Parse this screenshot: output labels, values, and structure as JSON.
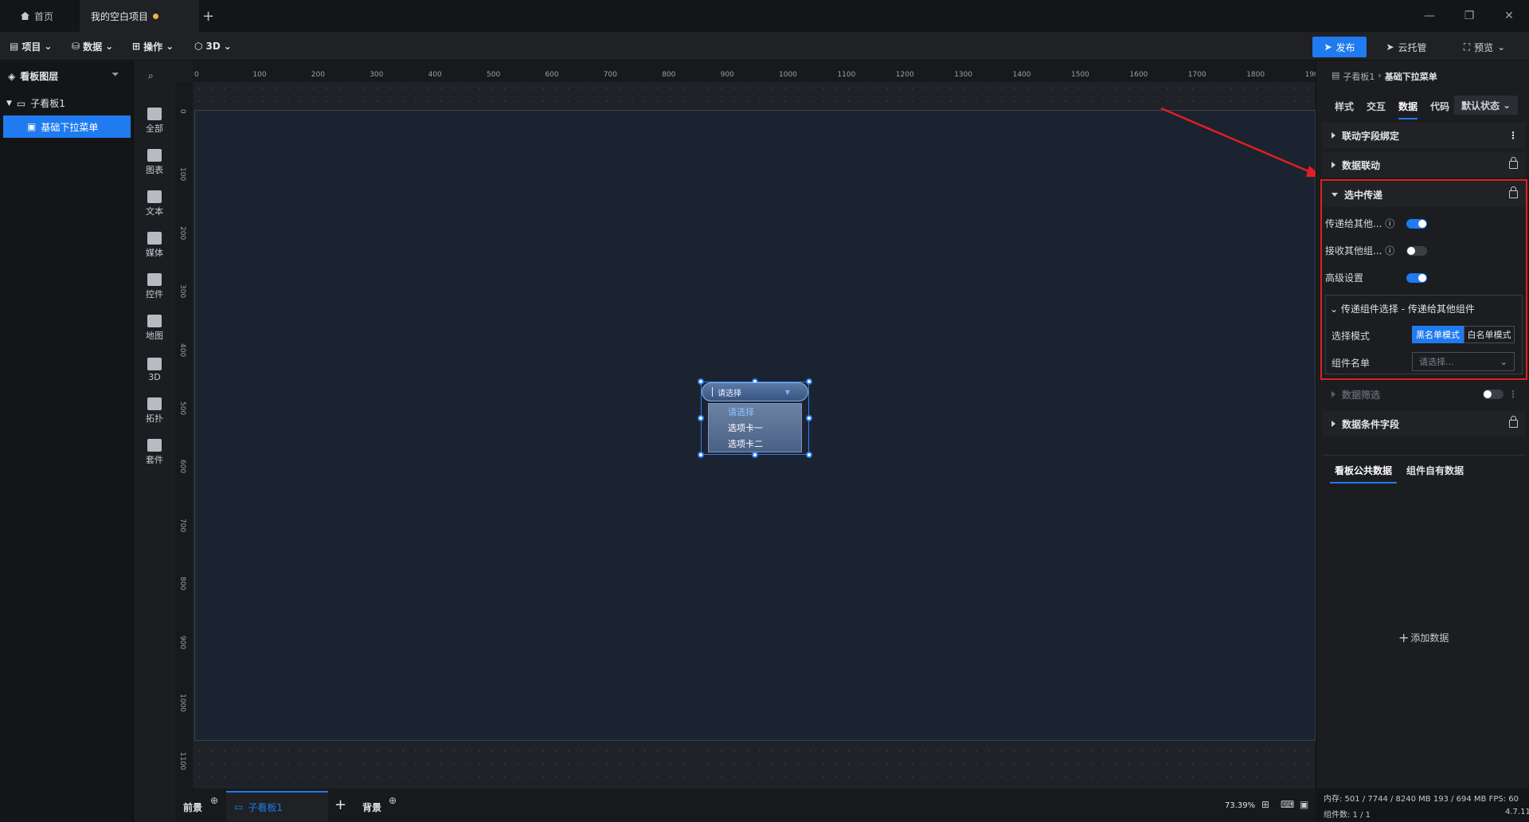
{
  "titlebar": {
    "home_tab": "首页",
    "project_tab": "我的空白项目",
    "add_tab": "+"
  },
  "menubar": {
    "project": "项目",
    "data": "数据",
    "operate": "操作",
    "three_d": "3D",
    "publish": "发布",
    "cloud": "云托管",
    "preview": "预览"
  },
  "layers": {
    "title": "看板图层",
    "tree": [
      {
        "label": "子看板1"
      },
      {
        "label": "基础下拉菜单"
      }
    ]
  },
  "iconbar": [
    "全部",
    "图表",
    "文本",
    "媒体",
    "控件",
    "地图",
    "3D",
    "拓扑",
    "套件"
  ],
  "ruler": {
    "top": [
      "0",
      "100",
      "200",
      "300",
      "400",
      "500",
      "600",
      "700",
      "800",
      "900",
      "1000",
      "1100",
      "1200",
      "1300",
      "1400",
      "1500",
      "1600",
      "1700",
      "1800",
      "1900"
    ],
    "left": [
      "0",
      "100",
      "200",
      "300",
      "400",
      "500",
      "600",
      "700",
      "800",
      "900",
      "1000",
      "1100"
    ]
  },
  "widget": {
    "placeholder": "请选择",
    "options": [
      "请选择",
      "选项卡一",
      "选项卡二"
    ]
  },
  "bottom": {
    "foreground": "前景",
    "board": "子看板1",
    "background": "背景",
    "zoom": "73.39%"
  },
  "right": {
    "breadcrumb_parent": "子看板1",
    "breadcrumb_current": "基础下拉菜单",
    "tabs": [
      "样式",
      "交互",
      "数据",
      "代码"
    ],
    "state": "默认状态",
    "sections": {
      "linkage_field": "联动字段绑定",
      "data_linkage": "数据联动",
      "selection_pass": "选中传递",
      "data_filter": "数据筛选",
      "condition_field": "数据条件字段"
    },
    "pass_to_others": "传递给其他...",
    "receive_others": "接收其他组...",
    "advanced": "高级设置",
    "sub_title": "传递组件选择 - 传递给其他组件",
    "select_mode": "选择模式",
    "blacklist": "黑名单模式",
    "whitelist": "白名单模式",
    "component_list": "组件名单",
    "select_placeholder": "请选择...",
    "data_tabs": [
      "看板公共数据",
      "组件自有数据"
    ],
    "add_data": "添加数据"
  },
  "status": {
    "memory": "内存: 501 / 7744 / 8240 MB 193 / 694 MB FPS: 60",
    "components": "组件数: 1 / 1",
    "version": "4.7.11"
  },
  "colors": {
    "accent": "#1f7bef",
    "highlight": "#e02020"
  }
}
